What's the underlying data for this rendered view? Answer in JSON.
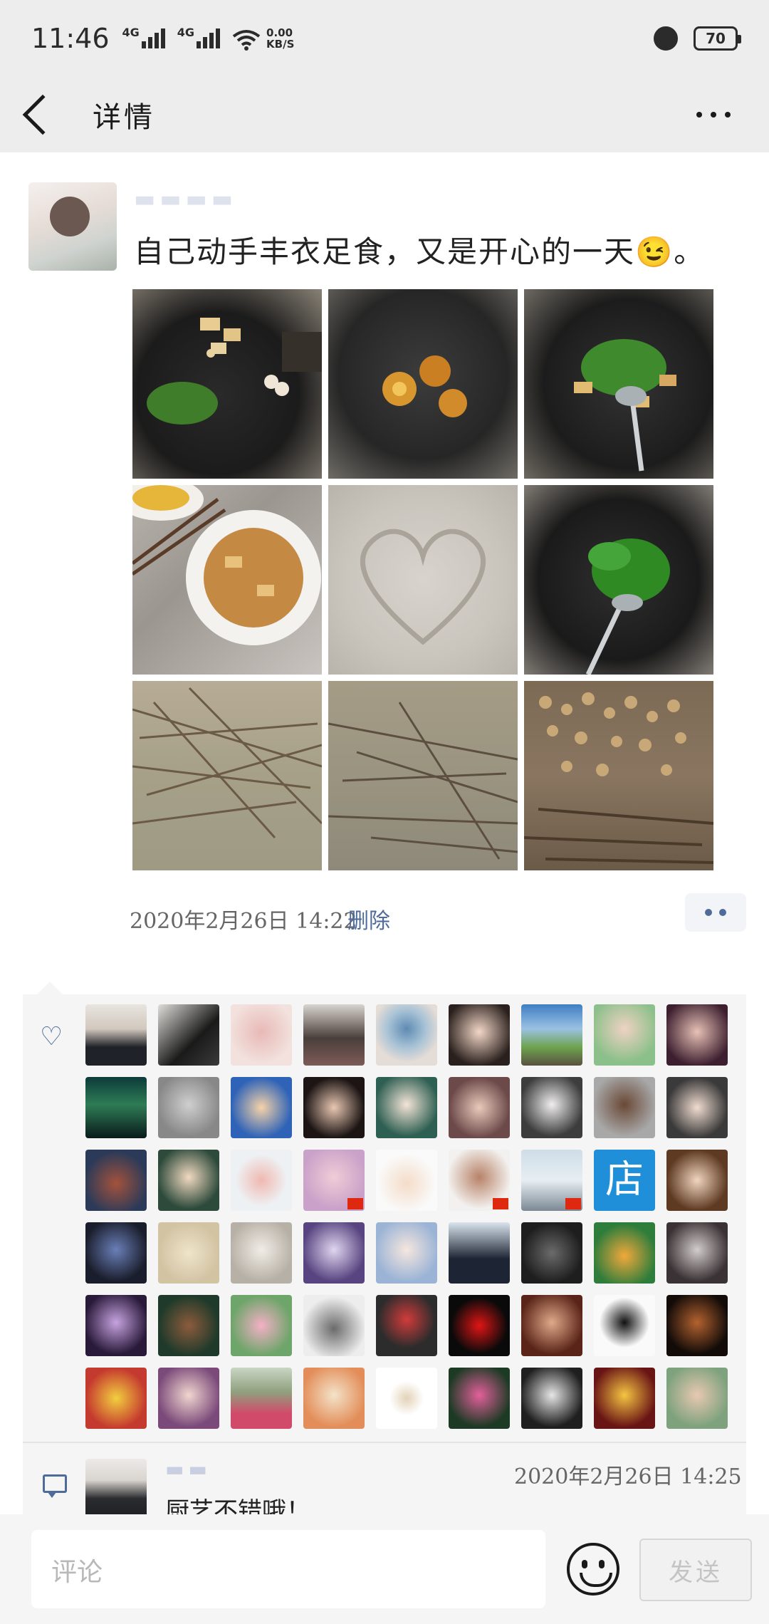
{
  "status_bar": {
    "time": "11:46",
    "signal1_label": "4G",
    "signal2_label": "4G",
    "speed_value": "0.00",
    "speed_unit": "KB/S",
    "battery": "70"
  },
  "nav": {
    "title": "详情"
  },
  "post": {
    "text": "自己动手丰衣足食，又是开心的一天😉。",
    "photos": [
      {
        "subject": "cutting-board-tofu-greens"
      },
      {
        "subject": "wok-fried-eggs"
      },
      {
        "subject": "wok-stir-fry-spatula"
      },
      {
        "subject": "plated-tofu-dish"
      },
      {
        "subject": "heart-in-sand"
      },
      {
        "subject": "wok-greens-spatula"
      },
      {
        "subject": "firewood-sticks-1"
      },
      {
        "subject": "firewood-sticks-2"
      },
      {
        "subject": "firewood-stacked"
      }
    ],
    "timestamp": "2020年2月26日  14:22",
    "delete_label": "删除"
  },
  "likes": {
    "count_visible": 54
  },
  "comment": {
    "time": "2020年2月26日  14:25",
    "text": "厨艺不错哦！"
  },
  "bottom_bar": {
    "input_placeholder": "评论",
    "send_label": "发送"
  },
  "colors": {
    "accent": "#4e6b9a",
    "background": "#ededed",
    "panel": "#f5f5f5"
  }
}
